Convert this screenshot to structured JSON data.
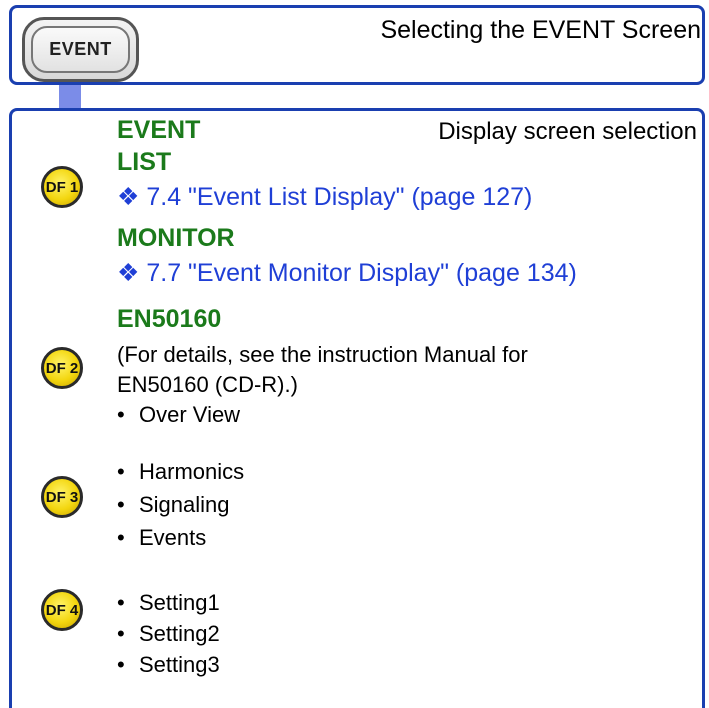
{
  "header": {
    "key_label": "EVENT",
    "title": "Selecting the EVENT Screen"
  },
  "section": {
    "heading": "EVENT",
    "subtitle": "Display screen selection"
  },
  "keys": {
    "df1": "DF 1",
    "df2": "DF 2",
    "df3": "DF 3",
    "df4": "DF 4"
  },
  "df1": {
    "list_title": "LIST",
    "list_link": "❖ 7.4 \"Event List Display\" (page 127)",
    "monitor_title": "MONITOR",
    "monitor_link": "❖ 7.7 \"Event Monitor Display\" (page 134)"
  },
  "df2": {
    "title": "EN50160",
    "note_line1": "(For details, see the instruction  Manual for",
    "note_line2": "EN50160 (CD-R).)",
    "items": [
      "Over View"
    ]
  },
  "df3": {
    "items": [
      "Harmonics",
      "Signaling",
      "Events"
    ]
  },
  "df4": {
    "items": [
      "Setting1",
      "Setting2",
      "Setting3"
    ]
  },
  "bullet_char": "•"
}
